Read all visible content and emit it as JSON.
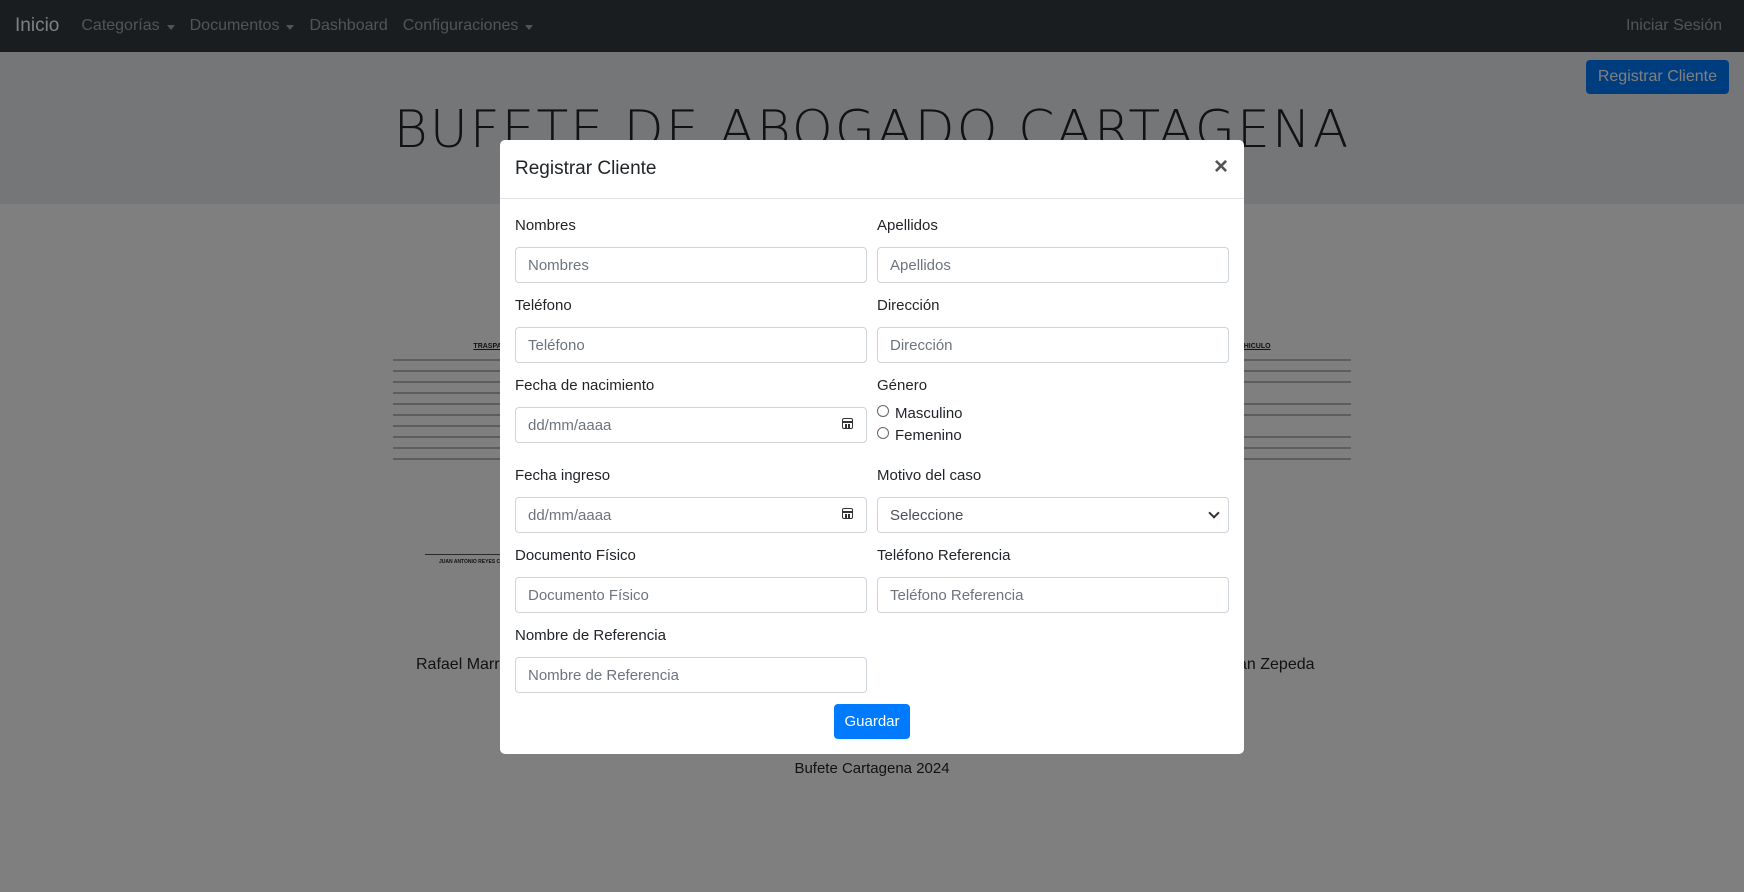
{
  "navbar": {
    "brand": "Inicio",
    "items": [
      "Categorías",
      "Documentos",
      "Dashboard",
      "Configuraciones"
    ],
    "login": "Iniciar Sesión"
  },
  "page": {
    "register_button": "Registrar Cliente",
    "title": "BUFETE DE ABOGADO CARTAGENA",
    "doc_heading": "TRASPASO DE VEHICULO",
    "doc_signer": "JUAN ANTONIO REYES CACERES",
    "person_left": "Rafael Marro",
    "person_right": "an Zepeda",
    "footer": "Bufete Cartagena 2024"
  },
  "modal": {
    "title": "Registrar Cliente",
    "close": "×",
    "fields": {
      "nombres": {
        "label": "Nombres",
        "placeholder": "Nombres"
      },
      "apellidos": {
        "label": "Apellidos",
        "placeholder": "Apellidos"
      },
      "telefono": {
        "label": "Teléfono",
        "placeholder": "Teléfono"
      },
      "direccion": {
        "label": "Dirección",
        "placeholder": "Dirección"
      },
      "fecha_nacimiento": {
        "label": "Fecha de nacimiento",
        "placeholder": "dd/mm/aaaa"
      },
      "genero": {
        "label": "Género",
        "options": [
          "Masculino",
          "Femenino"
        ]
      },
      "fecha_ingreso": {
        "label": "Fecha ingreso",
        "placeholder": "dd/mm/aaaa"
      },
      "motivo": {
        "label": "Motivo del caso",
        "value": "Seleccione"
      },
      "documento": {
        "label": "Documento Físico",
        "placeholder": "Documento Físico"
      },
      "telefono_ref": {
        "label": "Teléfono Referencia",
        "placeholder": "Teléfono Referencia"
      },
      "nombre_ref": {
        "label": "Nombre de Referencia",
        "placeholder": "Nombre de Referencia"
      }
    },
    "save": "Guardar"
  },
  "colors": {
    "navbar": "#343a40",
    "primary": "#007bff",
    "jumbotron": "#e9ecef"
  }
}
